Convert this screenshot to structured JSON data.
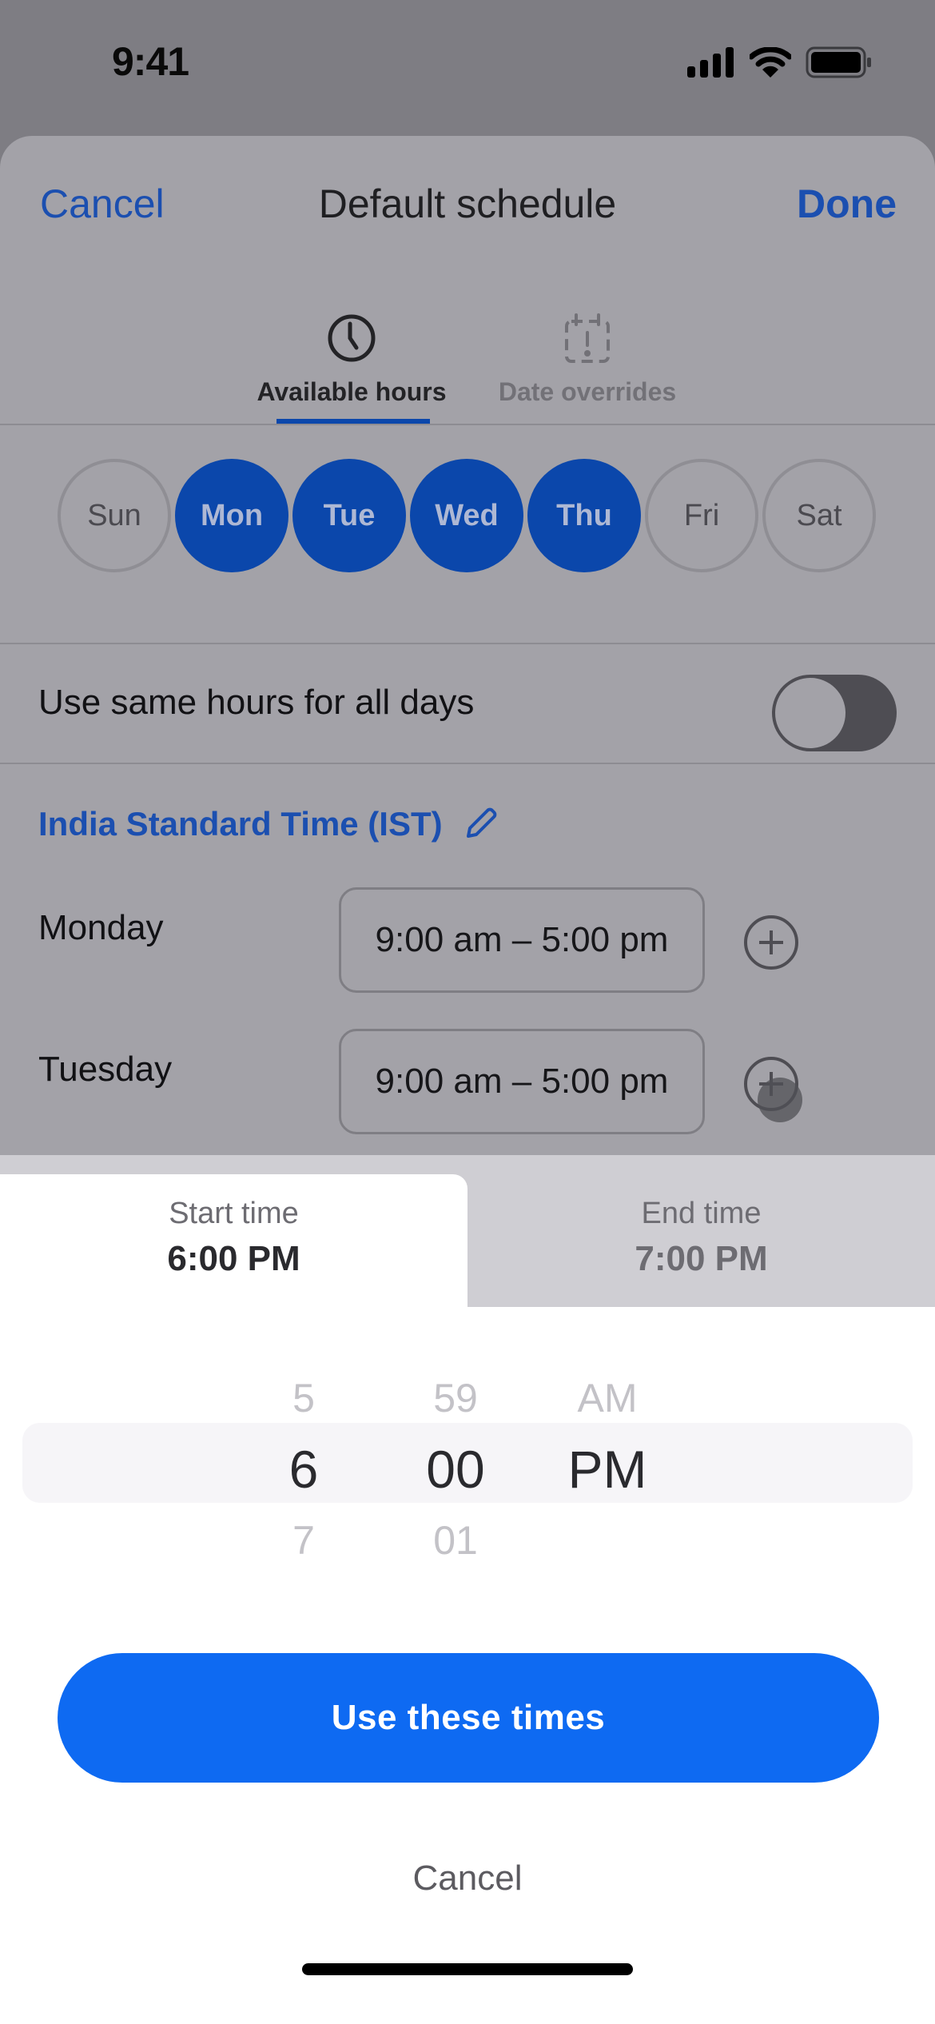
{
  "status_bar": {
    "time": "9:41",
    "icons": [
      "cellular-signal-icon",
      "wifi-icon",
      "battery-icon"
    ]
  },
  "nav": {
    "cancel_label": "Cancel",
    "title": "Default schedule",
    "done_label": "Done"
  },
  "tabs": [
    {
      "label": "Available hours",
      "icon": "clock-icon",
      "active": true
    },
    {
      "label": "Date overrides",
      "icon": "calendar-alert-icon",
      "active": false
    }
  ],
  "days": [
    {
      "label": "Sun",
      "selected": false
    },
    {
      "label": "Mon",
      "selected": true
    },
    {
      "label": "Tue",
      "selected": true
    },
    {
      "label": "Wed",
      "selected": true
    },
    {
      "label": "Thu",
      "selected": true
    },
    {
      "label": "Fri",
      "selected": false
    },
    {
      "label": "Sat",
      "selected": false
    }
  ],
  "same_hours": {
    "label": "Use same hours for all days",
    "enabled": false
  },
  "timezone": {
    "label": "India Standard Time (IST)",
    "icon": "pencil-icon"
  },
  "schedule_rows": [
    {
      "day": "Monday",
      "hours": "9:00 am – 5:00 pm",
      "add_icon": "plus-circle-icon"
    },
    {
      "day": "Tuesday",
      "hours": "9:00 am – 5:00 pm",
      "add_icon": "plus-circle-icon"
    }
  ],
  "picker": {
    "start_tab": {
      "label": "Start time",
      "value": "6:00 PM",
      "active": true
    },
    "end_tab": {
      "label": "End time",
      "value": "7:00 PM",
      "active": false
    },
    "hour": {
      "prev": "5",
      "selected": "6",
      "next": "7"
    },
    "minute": {
      "prev": "59",
      "selected": "00",
      "next": "01"
    },
    "ampm": {
      "prev": "AM",
      "selected": "PM",
      "next": ""
    },
    "confirm_label": "Use these times",
    "cancel_label": "Cancel"
  },
  "colors": {
    "accent": "#0e6af2",
    "accent_dimmed": "#0b47ab",
    "link_dimmed": "#1b4fb0"
  }
}
